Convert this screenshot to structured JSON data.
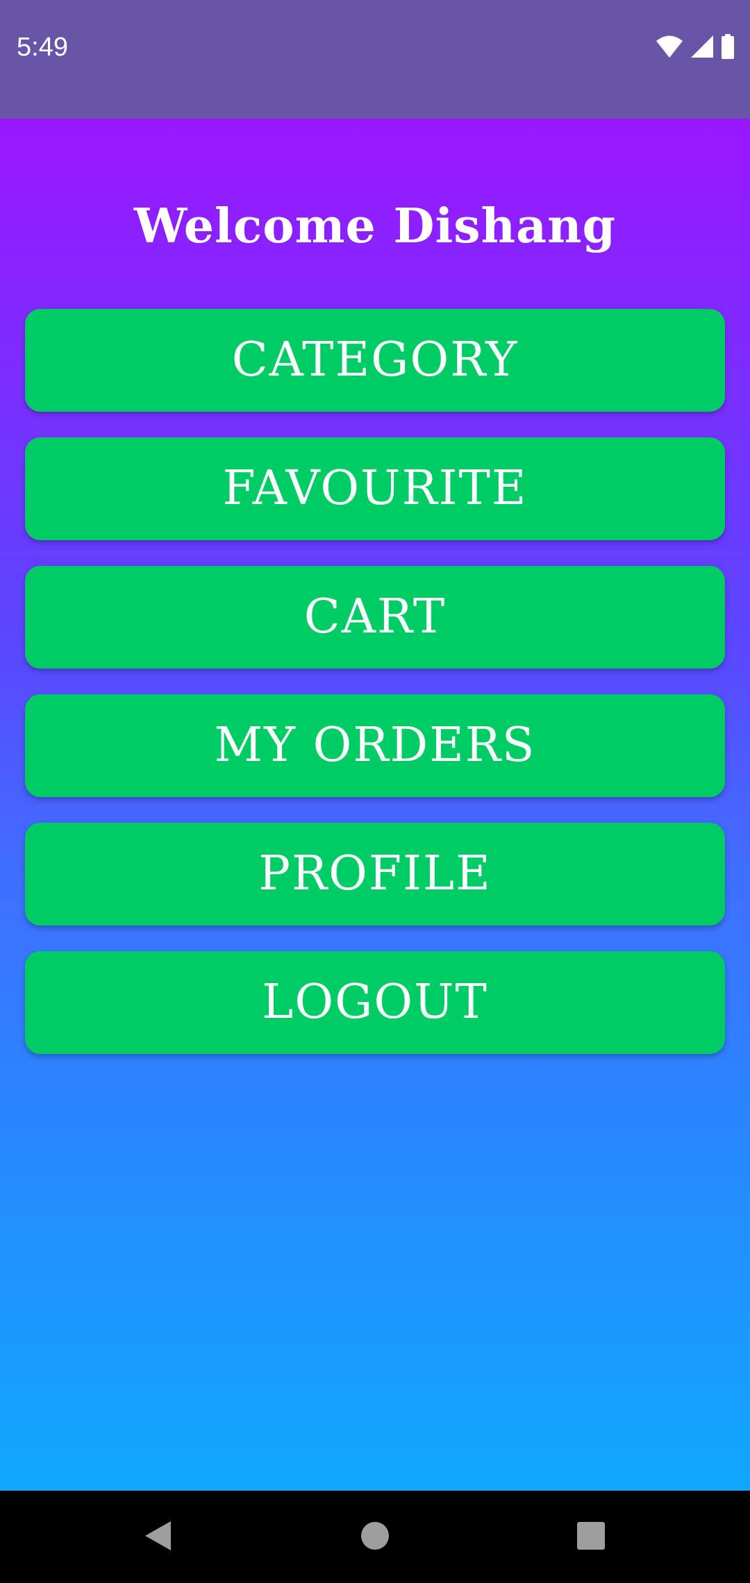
{
  "status_bar": {
    "time": "5:49",
    "icons": [
      "wifi-icon",
      "signal-icon",
      "battery-icon"
    ],
    "background": "#6755a5"
  },
  "main": {
    "welcome_text": "Welcome Dishang",
    "gradient_colors": [
      "#9a16ff",
      "#5b46ff",
      "#3f6fff",
      "#2a85ff",
      "#10a7ff"
    ],
    "button_color": "#00cc66",
    "buttons": [
      {
        "label": "CATEGORY"
      },
      {
        "label": "FAVOURITE"
      },
      {
        "label": "CART"
      },
      {
        "label": "MY ORDERS"
      },
      {
        "label": "PROFILE"
      },
      {
        "label": "LOGOUT"
      }
    ]
  },
  "nav_bar": {
    "icons": [
      "back-icon",
      "home-icon",
      "recents-icon"
    ]
  }
}
